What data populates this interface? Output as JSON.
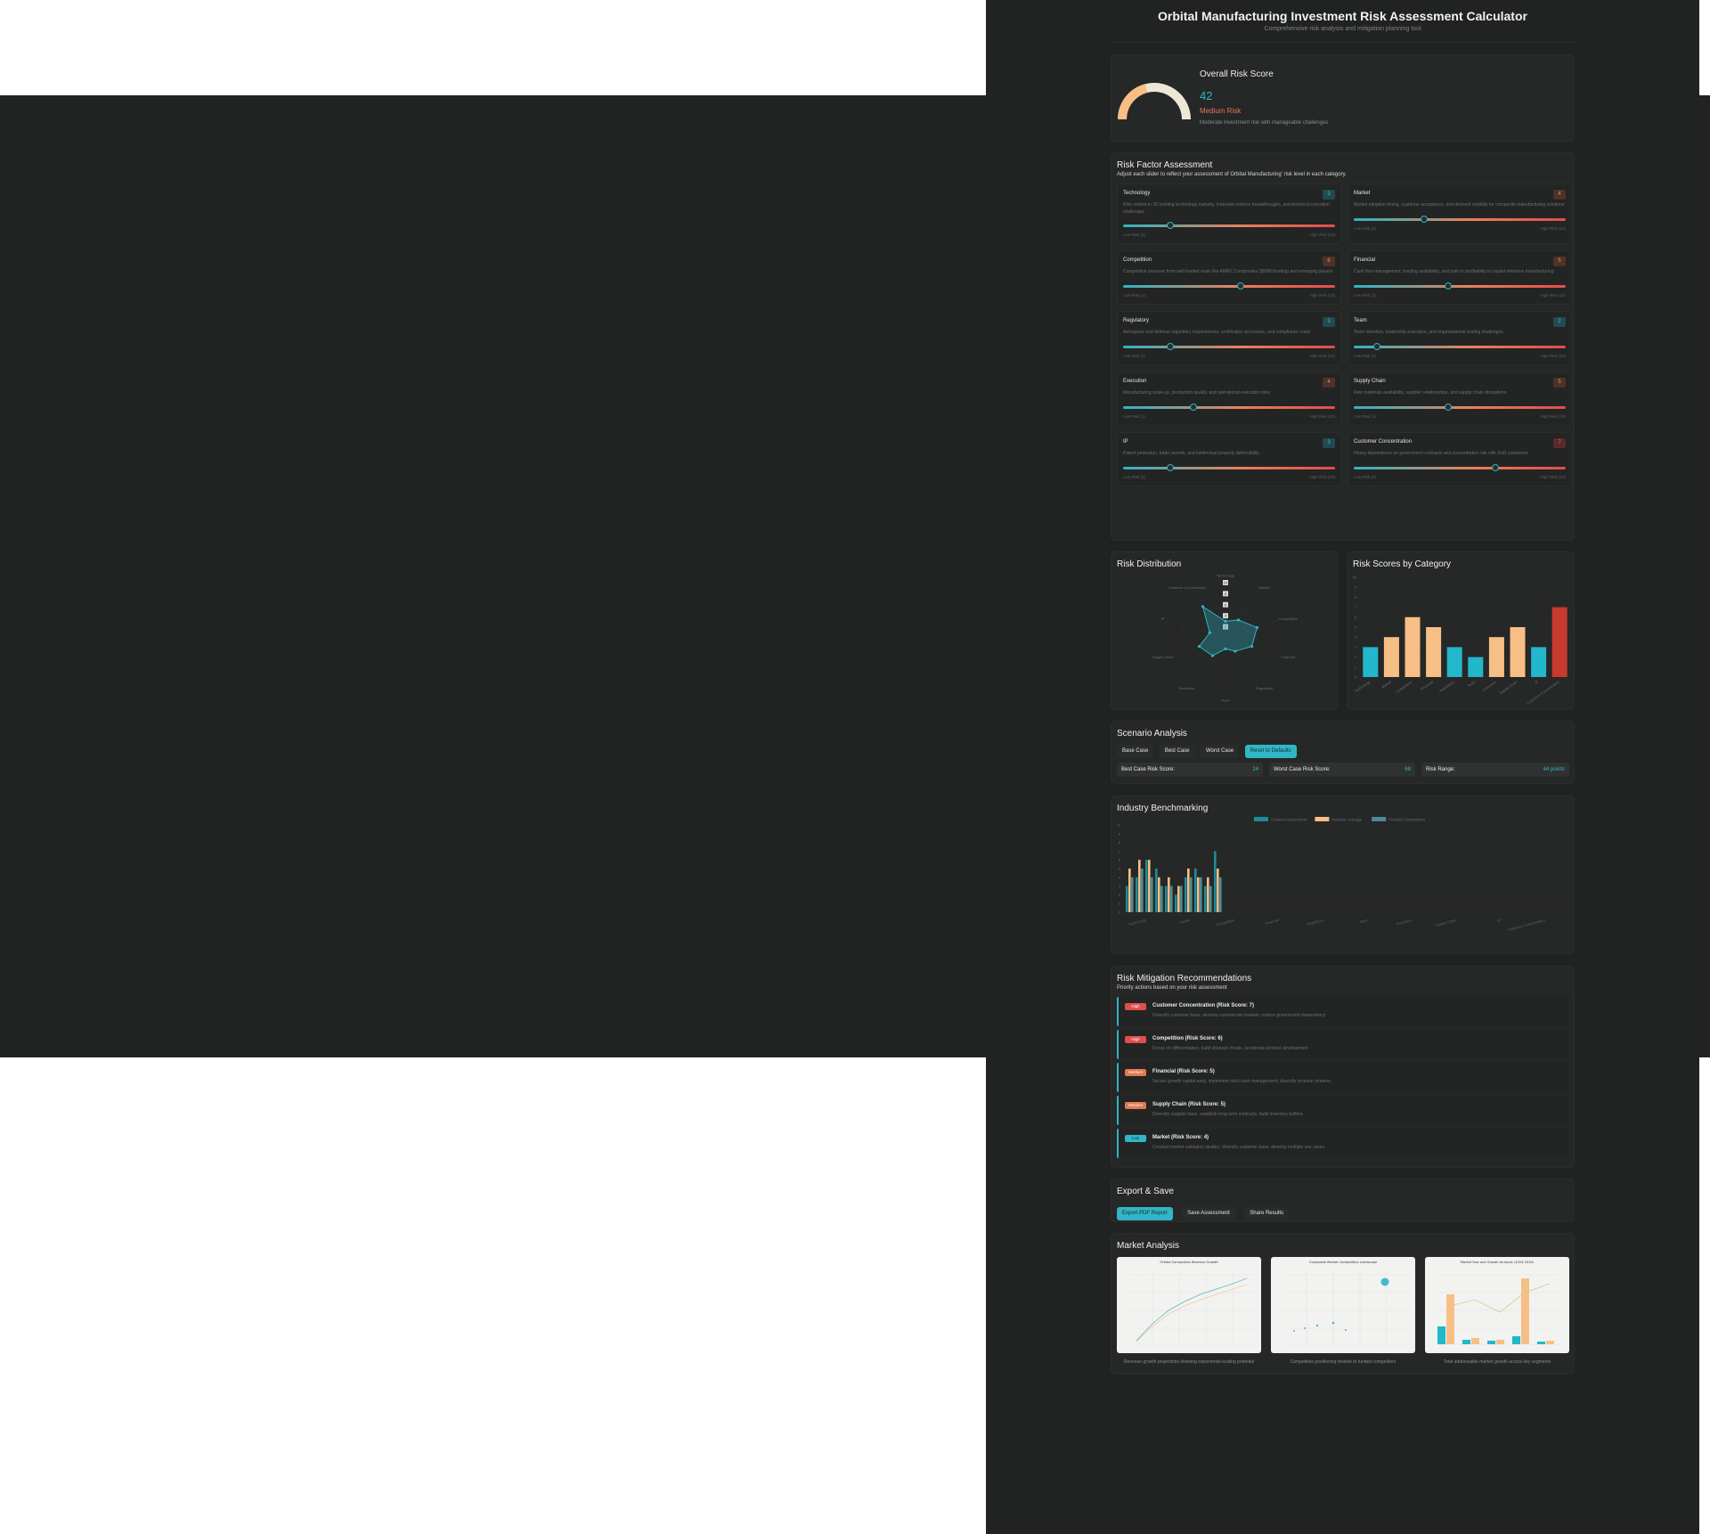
{
  "header": {
    "title": "Orbital Manufacturing Investment Risk Assessment Calculator",
    "subtitle": "Comprehensive risk analysis and mitigation planning tool"
  },
  "overall": {
    "title": "Overall Risk Score",
    "score": "42",
    "level": "Medium Risk",
    "description": "Moderate investment risk with manageable challenges",
    "gauge_fraction": 0.42
  },
  "risk_factors": {
    "title": "Risk Factor Assessment",
    "subtitle": "Adjust each slider to reflect your assessment of Orbital Manufacturing' risk level in each category.",
    "low_label": "Low Risk (1)",
    "high_label": "High Risk (10)",
    "items": [
      {
        "name": "Technology",
        "value": "3",
        "level": "low",
        "description": "Risk related to 3D printing technology maturity, materials science breakthroughs, and technical execution challenges"
      },
      {
        "name": "Market",
        "value": "4",
        "level": "med",
        "description": "Market adoption timing, customer acceptance, and demand volatility for composite manufacturing solutions"
      },
      {
        "name": "Competition",
        "value": "6",
        "level": "med",
        "description": "Competitive pressure from well-funded rivals like AMRC Composites ($90M funding) and emerging players"
      },
      {
        "name": "Financial",
        "value": "5",
        "level": "med",
        "description": "Cash flow management, funding availability, and path to profitability in capital-intensive manufacturing"
      },
      {
        "name": "Regulatory",
        "value": "3",
        "level": "low",
        "description": "Aerospace and defense regulatory requirements, certification processes, and compliance costs"
      },
      {
        "name": "Team",
        "value": "2",
        "level": "low",
        "description": "Team retention, leadership execution, and organizational scaling challenges"
      },
      {
        "name": "Execution",
        "value": "4",
        "level": "med",
        "description": "Manufacturing scale-up, production quality, and operational execution risks"
      },
      {
        "name": "Supply Chain",
        "value": "5",
        "level": "med",
        "description": "Raw materials availability, supplier relationships, and supply chain disruptions"
      },
      {
        "name": "IP",
        "value": "3",
        "level": "low",
        "description": "Patent protection, trade secrets, and intellectual property defensibility"
      },
      {
        "name": "Customer Concentration",
        "value": "7",
        "level": "high",
        "description": "Heavy dependence on government contracts and concentration risk with DoD customers"
      }
    ]
  },
  "charts": {
    "radar_title": "Risk Distribution",
    "bar_title": "Risk Scores by Category"
  },
  "chart_data": [
    {
      "type": "radar",
      "title": "Risk Distribution",
      "categories": [
        "Technology",
        "Market",
        "Competition",
        "Financial",
        "Regulatory",
        "Team",
        "Execution",
        "Supply Chain",
        "IP",
        "Customer Concentration"
      ],
      "values": [
        3,
        4,
        6,
        5,
        3,
        2,
        4,
        5,
        3,
        7
      ],
      "ticks": [
        "10",
        "8",
        "6",
        "4",
        "2"
      ],
      "rlim": [
        0,
        10
      ]
    },
    {
      "type": "bar",
      "title": "Risk Scores by Category",
      "categories": [
        "Technology",
        "Market",
        "Competition",
        "Financial",
        "Regulatory",
        "Team",
        "Execution",
        "Supply Chain",
        "IP",
        "Customer Concentration"
      ],
      "values": [
        3,
        4,
        6,
        5,
        3,
        2,
        4,
        5,
        3,
        7
      ],
      "colors": [
        "#22b7cb",
        "#f7bf86",
        "#f7bf86",
        "#f7bf86",
        "#22b7cb",
        "#22b7cb",
        "#f7bf86",
        "#f7bf86",
        "#22b7cb",
        "#c8392e"
      ],
      "yticks": [
        "0",
        "1",
        "2",
        "3",
        "4",
        "5",
        "6",
        "7",
        "8",
        "9",
        "10"
      ],
      "ylim": [
        0,
        10
      ]
    },
    {
      "type": "bar",
      "title": "Industry Benchmarking",
      "categories": [
        "Technology",
        "Market",
        "Competition",
        "Financial",
        "Regulatory",
        "Team",
        "Execution",
        "Supply Chain",
        "IP",
        "Customer Concentration"
      ],
      "series": [
        {
          "name": "Current Assessment",
          "values": [
            3,
            4,
            6,
            5,
            3,
            2,
            4,
            5,
            3,
            7
          ],
          "color": "#1e8c9a"
        },
        {
          "name": "Industry Average",
          "values": [
            5,
            6,
            6,
            4,
            4,
            3,
            5,
            4,
            4,
            5
          ],
          "color": "#f7bf86"
        },
        {
          "name": "Funded Competitors",
          "values": [
            4,
            5,
            4,
            3,
            3,
            3,
            4,
            4,
            3,
            4
          ],
          "color": "#4e8b97"
        }
      ],
      "yticks": [
        "0",
        "1",
        "2",
        "3",
        "4",
        "5",
        "6",
        "7",
        "8",
        "9",
        "10"
      ],
      "ylim": [
        0,
        10
      ]
    }
  ],
  "scenario": {
    "title": "Scenario Analysis",
    "buttons": [
      "Base Case",
      "Best Case",
      "Worst Case",
      "Reset to Defaults"
    ],
    "best_label": "Best Case Risk Score:",
    "best_value": "24",
    "worst_label": "Worst Case Risk Score:",
    "worst_value": "68",
    "range_label": "Risk Range:",
    "range_value": "44 points"
  },
  "benchmark": {
    "title": "Industry Benchmarking",
    "legend": [
      "Current Assessment",
      "Industry Average",
      "Funded Competitors"
    ]
  },
  "mitigation": {
    "title": "Risk Mitigation Recommendations",
    "subtitle": "Priority actions based on your risk assessment",
    "items": [
      {
        "badge": "High",
        "level": "high",
        "title": "Customer Concentration (Risk Score: 7)",
        "text": "Diversify customer base, develop commercial markets, reduce government dependency"
      },
      {
        "badge": "High",
        "level": "high",
        "title": "Competition (Risk Score: 6)",
        "text": "Focus on differentiation, build strategic moats, accelerate product development"
      },
      {
        "badge": "Medium",
        "level": "med",
        "title": "Financial (Risk Score: 5)",
        "text": "Secure growth capital early, implement strict cash management, diversify revenue streams"
      },
      {
        "badge": "Medium",
        "level": "med",
        "title": "Supply Chain (Risk Score: 5)",
        "text": "Diversify supplier base, establish long-term contracts, build inventory buffers"
      },
      {
        "badge": "Low",
        "level": "low",
        "title": "Market (Risk Score: 4)",
        "text": "Conduct market validation studies, diversify customer base, develop multiple use cases"
      }
    ]
  },
  "export": {
    "title": "Export & Save",
    "buttons": [
      "Export PDF Report",
      "Save Assessment",
      "Share Results"
    ]
  },
  "market": {
    "title": "Market Analysis",
    "images": [
      {
        "title": "Orbital Composites Revenue Growth",
        "caption": "Revenue growth projections showing exponential scaling potential"
      },
      {
        "title": "Composite Market Competitive Landscape",
        "caption": "Competitive positioning relative to funded competitors"
      },
      {
        "title": "Market Size and Growth Analysis (2024-2030)",
        "caption": "Total addressable market growth across key segments"
      }
    ]
  }
}
